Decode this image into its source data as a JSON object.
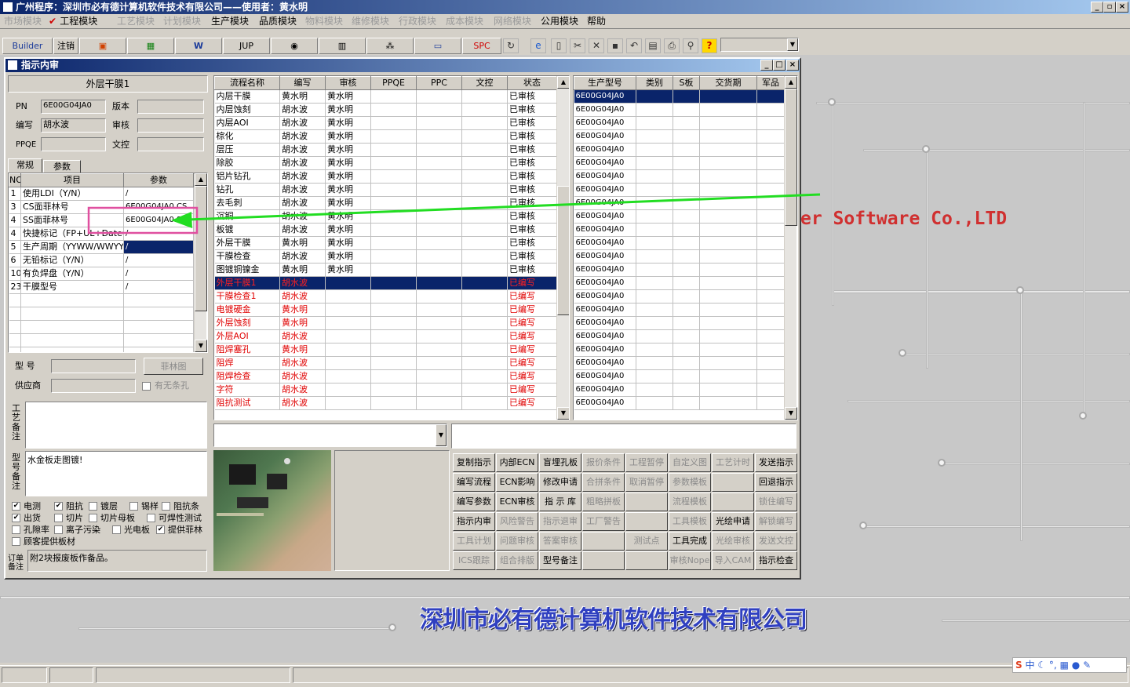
{
  "app": {
    "title": "广州程序：深圳市必有德计算机软件技术有限公司——使用者：黄水明"
  },
  "menu": [
    {
      "label": "市场模块",
      "enabled": false
    },
    {
      "label": "工程模块",
      "enabled": true,
      "checked": true
    },
    {
      "label": "工艺模块",
      "enabled": false
    },
    {
      "label": "计划模块",
      "enabled": false
    },
    {
      "label": "生产模块",
      "enabled": true
    },
    {
      "label": "品质模块",
      "enabled": true
    },
    {
      "label": "物料模块",
      "enabled": false
    },
    {
      "label": "维修模块",
      "enabled": false
    },
    {
      "label": "行政模块",
      "enabled": false
    },
    {
      "label": "成本模块",
      "enabled": false
    },
    {
      "label": "网络模块",
      "enabled": false
    },
    {
      "label": "公用模块",
      "enabled": true
    },
    {
      "label": "帮助",
      "enabled": true
    }
  ],
  "toolbar": {
    "builder": "Builder",
    "logout": "注销",
    "jup": "JUP",
    "spc": "SPC"
  },
  "desktop": {
    "company_en": "er Software Co.,LTD",
    "company_cn": "深圳市必有德计算机软件技术有限公司"
  },
  "window": {
    "title": "指示内审"
  },
  "left": {
    "header": "外层干膜1",
    "pn_label": "PN",
    "pn_value": "6E00G04JA0",
    "version_label": "版本",
    "version_value": "",
    "writer_label": "编写",
    "writer_value": "胡水波",
    "review_label": "审核",
    "review_value": "",
    "ppqe_label": "PPQE",
    "ppqe_value": "",
    "wenkong_label": "文控",
    "wenkong_value": "",
    "tabs": [
      "常规",
      "参数"
    ],
    "param_headers": [
      "NO",
      "项目",
      "参数"
    ],
    "params": [
      {
        "no": "1",
        "item": "使用LDI（Y/N）",
        "value": "/"
      },
      {
        "no": "3",
        "item": "CS面菲林号",
        "value": "6E00G04JA0.CS"
      },
      {
        "no": "4",
        "item": "SS面菲林号",
        "value": "6E00G04JA0.SS"
      },
      {
        "no": "4",
        "item": "快捷标记（FP+UL+DateC",
        "value": "/"
      },
      {
        "no": "5",
        "item": "生产周期（YYWW/WWYY）",
        "value": "/"
      },
      {
        "no": "6",
        "item": "无铅标记（Y/N）",
        "value": "/"
      },
      {
        "no": "10",
        "item": "有负焊盘（Y/N）",
        "value": "/"
      },
      {
        "no": "23",
        "item": "干膜型号",
        "value": "/"
      }
    ],
    "model_label": "型  号",
    "model_value": "",
    "film_button": "菲林图",
    "supplier_label": "供应商",
    "supplier_value": "",
    "hole_check": "有无条孔",
    "process_note_label": "工艺备注",
    "process_note": "",
    "model_note_label": "型号备注",
    "model_note": "水金板走图镀!",
    "checks": [
      {
        "label": "电测",
        "checked": true
      },
      {
        "label": "阻抗",
        "checked": true
      },
      {
        "label": "镀层",
        "checked": false
      },
      {
        "label": "锡样",
        "checked": false
      },
      {
        "label": "阻抗条",
        "checked": false
      },
      {
        "label": "出货",
        "checked": true
      },
      {
        "label": "切片",
        "checked": false
      },
      {
        "label": "切片母板",
        "checked": false
      },
      {
        "label": "可焊性测试",
        "checked": false
      },
      {
        "label": "孔隙率",
        "checked": false
      },
      {
        "label": "离子污染",
        "checked": false
      },
      {
        "label": "光电板",
        "checked": false
      },
      {
        "label": "提供菲林",
        "checked": true
      },
      {
        "label": "顾客提供板材",
        "checked": false
      }
    ],
    "order_note_label": "订单备注",
    "order_note": "附2块报废板作备品。"
  },
  "flow": {
    "headers": [
      "流程名称",
      "编写",
      "审核",
      "PPQE",
      "PPC",
      "文控",
      "状态"
    ],
    "rows": [
      [
        "内层干膜",
        "黄水明",
        "黄水明",
        "",
        "",
        "",
        "已审核"
      ],
      [
        "内层蚀刻",
        "胡水波",
        "黄水明",
        "",
        "",
        "",
        "已审核"
      ],
      [
        "内层AOI",
        "胡水波",
        "黄水明",
        "",
        "",
        "",
        "已审核"
      ],
      [
        "棕化",
        "胡水波",
        "黄水明",
        "",
        "",
        "",
        "已审核"
      ],
      [
        "层压",
        "胡水波",
        "黄水明",
        "",
        "",
        "",
        "已审核"
      ],
      [
        "除胶",
        "胡水波",
        "黄水明",
        "",
        "",
        "",
        "已审核"
      ],
      [
        "铝片钻孔",
        "胡水波",
        "黄水明",
        "",
        "",
        "",
        "已审核"
      ],
      [
        "钻孔",
        "胡水波",
        "黄水明",
        "",
        "",
        "",
        "已审核"
      ],
      [
        "去毛刺",
        "胡水波",
        "黄水明",
        "",
        "",
        "",
        "已审核"
      ],
      [
        "沉铜",
        "胡水波",
        "黄水明",
        "",
        "",
        "",
        "已审核"
      ],
      [
        "板镀",
        "胡水波",
        "黄水明",
        "",
        "",
        "",
        "已审核"
      ],
      [
        "外层干膜",
        "黄水明",
        "黄水明",
        "",
        "",
        "",
        "已审核"
      ],
      [
        "干膜检查",
        "胡水波",
        "黄水明",
        "",
        "",
        "",
        "已审核"
      ],
      [
        "图镀铜镍金",
        "黄水明",
        "黄水明",
        "",
        "",
        "",
        "已审核"
      ],
      [
        "外层干膜1",
        "胡水波",
        "",
        "",
        "",
        "",
        "已编写"
      ],
      [
        "干膜检查1",
        "胡水波",
        "",
        "",
        "",
        "",
        "已编写"
      ],
      [
        "电镀硬金",
        "黄水明",
        "",
        "",
        "",
        "",
        "已编写"
      ],
      [
        "外层蚀刻",
        "黄水明",
        "",
        "",
        "",
        "",
        "已编写"
      ],
      [
        "外层AOI",
        "胡水波",
        "",
        "",
        "",
        "",
        "已编写"
      ],
      [
        "阻焊塞孔",
        "黄水明",
        "",
        "",
        "",
        "",
        "已编写"
      ],
      [
        "阻焊",
        "胡水波",
        "",
        "",
        "",
        "",
        "已编写"
      ],
      [
        "阻焊检查",
        "胡水波",
        "",
        "",
        "",
        "",
        "已编写"
      ],
      [
        "字符",
        "胡水波",
        "",
        "",
        "",
        "",
        "已编写"
      ],
      [
        "阻抗测试",
        "胡水波",
        "",
        "",
        "",
        "",
        "已编写"
      ]
    ]
  },
  "prod": {
    "headers": [
      "生产型号",
      "类别",
      "S板",
      "交货期",
      "军品"
    ],
    "rows": [
      "6E00G04JA0",
      "6E00G04JA0",
      "6E00G04JA0",
      "6E00G04JA0",
      "6E00G04JA0",
      "6E00G04JA0",
      "6E00G04JA0",
      "6E00G04JA0",
      "6E00G04JA0",
      "6E00G04JA0",
      "6E00G04JA0",
      "6E00G04JA0",
      "6E00G04JA0",
      "6E00G04JA0",
      "6E00G04JA0",
      "6E00G04JA0",
      "6E00G04JA0",
      "6E00G04JA0",
      "6E00G04JA0",
      "6E00G04JA0",
      "6E00G04JA0",
      "6E00G04JA0",
      "6E00G04JA0",
      "6E00G04JA0"
    ]
  },
  "actions": [
    [
      {
        "label": "复制指示",
        "enabled": true
      },
      {
        "label": "内部ECN",
        "enabled": true
      },
      {
        "label": "盲埋孔板",
        "enabled": true
      },
      {
        "label": "报价条件",
        "enabled": false
      },
      {
        "label": "工程暂停",
        "enabled": false
      },
      {
        "label": "自定义图",
        "enabled": false
      },
      {
        "label": "工艺计时",
        "enabled": false
      },
      {
        "label": "发送指示",
        "enabled": true
      }
    ],
    [
      {
        "label": "编写流程",
        "enabled": true
      },
      {
        "label": "ECN影响",
        "enabled": true
      },
      {
        "label": "修改申请",
        "enabled": true
      },
      {
        "label": "合拼条件",
        "enabled": false
      },
      {
        "label": "取消暂停",
        "enabled": false
      },
      {
        "label": "参数模板",
        "enabled": false
      },
      {
        "label": "",
        "enabled": false
      },
      {
        "label": "回退指示",
        "enabled": true
      }
    ],
    [
      {
        "label": "编写参数",
        "enabled": true
      },
      {
        "label": "ECN审核",
        "enabled": true
      },
      {
        "label": "指 示 库",
        "enabled": true
      },
      {
        "label": "粗略拼板",
        "enabled": false
      },
      {
        "label": "",
        "enabled": false
      },
      {
        "label": "流程模板",
        "enabled": false
      },
      {
        "label": "",
        "enabled": false
      },
      {
        "label": "锁住编写",
        "enabled": false
      }
    ],
    [
      {
        "label": "指示内审",
        "enabled": true
      },
      {
        "label": "风险警告",
        "enabled": false
      },
      {
        "label": "指示退审",
        "enabled": false
      },
      {
        "label": "工厂警告",
        "enabled": false
      },
      {
        "label": "",
        "enabled": false
      },
      {
        "label": "工具模板",
        "enabled": false
      },
      {
        "label": "光绘申请",
        "enabled": true
      },
      {
        "label": "解锁编写",
        "enabled": false
      }
    ],
    [
      {
        "label": "工具计划",
        "enabled": false
      },
      {
        "label": "问题审核",
        "enabled": false
      },
      {
        "label": "答案审核",
        "enabled": false
      },
      {
        "label": "",
        "enabled": false
      },
      {
        "label": "测试点",
        "enabled": false
      },
      {
        "label": "工具完成",
        "enabled": true
      },
      {
        "label": "光绘审核",
        "enabled": false
      },
      {
        "label": "发送文控",
        "enabled": false
      }
    ],
    [
      {
        "label": "ICS跟踪",
        "enabled": false
      },
      {
        "label": "组合排版",
        "enabled": false
      },
      {
        "label": "型号备注",
        "enabled": true
      },
      {
        "label": "",
        "enabled": false
      },
      {
        "label": "",
        "enabled": false
      },
      {
        "label": "审核Nope",
        "enabled": false
      },
      {
        "label": "导入CAM",
        "enabled": false
      },
      {
        "label": "指示检查",
        "enabled": true
      }
    ]
  ],
  "colors": {
    "titlebar": "#0a246a",
    "selection": "#0a246a",
    "written": "#e00000",
    "annotation_arrow": "#22dd22",
    "annotation_box": "#e050a0",
    "company_text": "#3040c0"
  }
}
